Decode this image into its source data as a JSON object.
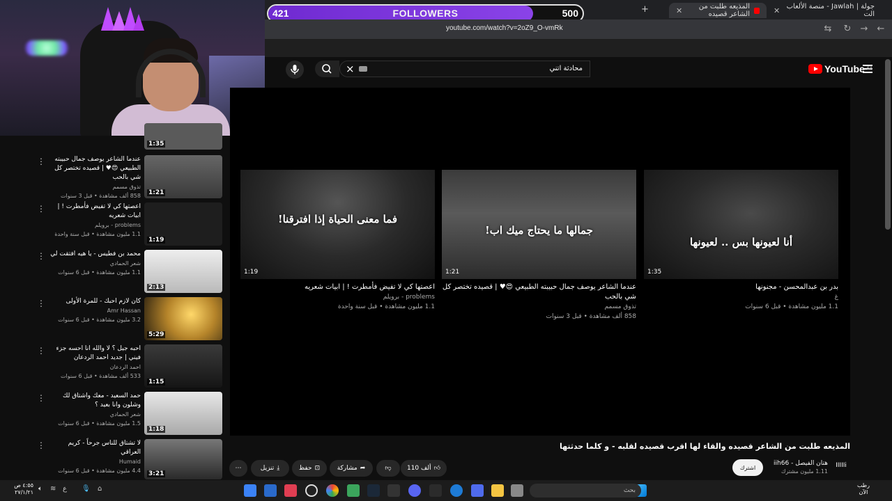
{
  "followers": {
    "current": "421",
    "label": "FOLLOWERS",
    "goal": "500",
    "progress": 0.842
  },
  "browser": {
    "tabs": [
      {
        "title": "المذيعه طلبت من الشاعر قصيده",
        "active": true
      },
      {
        "title": "جولة | Jawlah - منصة الألعاب الت",
        "active": false
      }
    ],
    "url": "youtube.com/watch?v=2oZ9_O-vmRk"
  },
  "youtube": {
    "logo_text": "YouTube",
    "region": "SA",
    "search_value": "محادثة اتني"
  },
  "endcards": [
    {
      "caption": "أنا لعيونها بس .. لعيونها",
      "duration": "1:35",
      "title": "بدر بن عبدالمحسن - مجنونها",
      "channel": "غ",
      "meta": "1.1 مليون مشاهدة • قبل 6 سنوات"
    },
    {
      "caption": "جمالها ما يحتاج ميك اب!",
      "duration": "1:21",
      "title": "عندما الشاعر يوصف جمال حبيبته الطبيعي 😍♥ | قصيده تختصر كل شي بالحب",
      "channel": "تذوق مسمم",
      "meta": "858 ألف مشاهدة • قبل 3 سنوات"
    },
    {
      "caption": "فما معنى الحياة إذا افترقنا!",
      "duration": "1:19",
      "title": "اعصتها كي لا تفيض فأمطرت ! | ابيات شعريه",
      "channel": "problems - برويلم",
      "meta": "1.1 مليون مشاهدة • قبل سنة واحدة"
    }
  ],
  "sidebar": [
    {
      "title": "",
      "channel": "",
      "meta": "",
      "duration": "1:35"
    },
    {
      "title": "عندما الشاعر يوصف جمال حبيبته الطبيعي 😍♥ | قصيده تختصر كل شي بالحب",
      "channel": "تذوق مسمم",
      "meta": "858 ألف مشاهدة • قبل 3 سنوات",
      "duration": "1:21"
    },
    {
      "title": "اعصتها كي لا تفيض فأمطرت ! | ابيات شعريه",
      "channel": "problems - برويلم",
      "meta": "1.1 مليون مشاهدة • قبل سنة واحدة",
      "duration": "1:19"
    },
    {
      "title": "محمد بن فطيس - يا هيه افتقت لي",
      "channel": "شعر الحمادي",
      "meta": "1.1 مليون مشاهدة • قبل 6 سنوات",
      "duration": "2:13"
    },
    {
      "title": "كان لازم احبك - للمرة الأولى",
      "channel": "Amr Hassan",
      "meta": "3.2 مليون مشاهدة • قبل 6 سنوات",
      "duration": "5:29"
    },
    {
      "title": "احبه جيل ؟ لا والله انا احسه جزء فيني | جديد احمد الردعان",
      "channel": "احمد الردعان",
      "meta": "533 ألف مشاهدة • قبل 6 سنوات",
      "duration": "1:15"
    },
    {
      "title": "حمد السعيد - معك واشتاق لك وشلون وانا بعيد ؟",
      "channel": "شعر الحمادي",
      "meta": "1.5 مليون مشاهدة • قبل 6 سنوات",
      "duration": "1:18"
    },
    {
      "title": "لا تشتاق للناس جرحاً - كريم العراقي",
      "channel": "Humaid",
      "meta": "4.4 مليون مشاهدة • قبل 6 سنوات",
      "duration": "3:21"
    }
  ],
  "video": {
    "title": "المذيعه طلبت من الشاعر قصيده والقاء لها اقرب قصيده لقلبه - و كلما حدثتها",
    "channel_name": "هتان الفيصل - iih66",
    "subscribers": "1.11 مليون مشترك",
    "subscribe_label": "اشترك",
    "like_count": "110 ألف",
    "share_label": "مشاركة",
    "save_label": "حفظ",
    "download_label": "تنزيل"
  },
  "taskbar": {
    "search_placeholder": "بحث",
    "time": "٤:٥٥ ص",
    "date": "٢٧/١/٢١",
    "lang": "ع",
    "weather": "رطب الآن"
  },
  "colors": {
    "accent": "#7c3aed",
    "youtube_red": "#ff0000",
    "bg": "#0f0f0f"
  }
}
